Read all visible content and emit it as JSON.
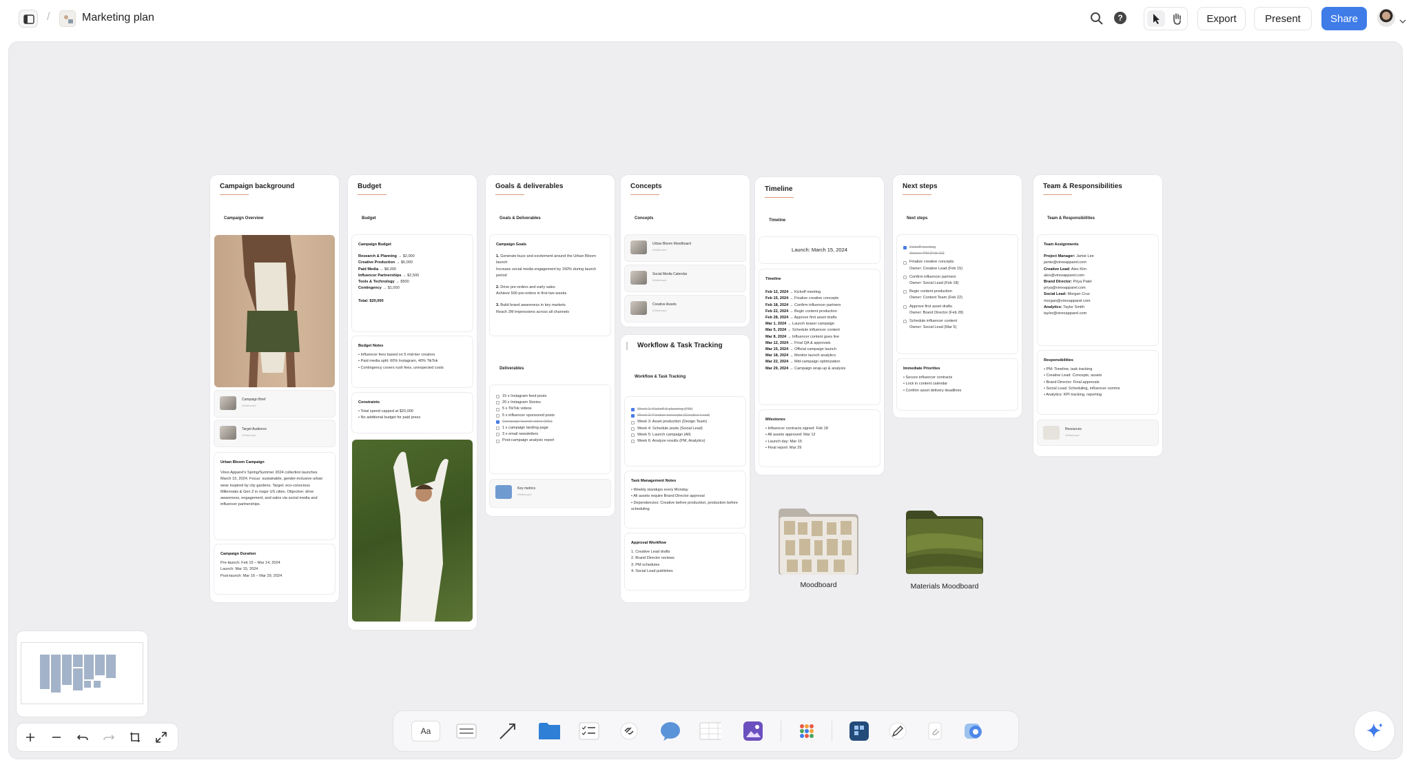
{
  "topbar": {
    "title": "Marketing plan",
    "export": "Export",
    "present": "Present",
    "share": "Share",
    "accent": "#3f7ce8"
  },
  "columns": [
    {
      "title": "Campaign background",
      "sub": "Campaign Overview",
      "minis": [
        {
          "t": "Campaign Brief",
          "s": "Whiteboard"
        },
        {
          "t": "Target Audience",
          "s": "Whiteboard"
        }
      ],
      "card_urban": {
        "h": "Urban Bloom Campaign",
        "body": "Vireo Apparel's Spring/Summer 2024 collection launches March 15, 2024. Focus: sustainable, gender-inclusive urban wear inspired by city gardens. Target: eco-conscious Millennials & Gen Z in major US cities. Objective: drive awareness, engagement, and sales via social media and influencer partnerships."
      },
      "card_duration": {
        "h": "Campaign Duration",
        "l1": "Pre-launch: Feb 15 – Mar 14, 2024",
        "l2": "Launch: Mar 15, 2024",
        "l3": "Post-launch: Mar 16 – Mar 29, 2024"
      }
    },
    {
      "title": "Budget",
      "sub": "Budget",
      "budget": {
        "h": "Campaign Budget",
        "rows": [
          {
            "k": "Research & Planning",
            "v": " → $2,000"
          },
          {
            "k": "Creative Production",
            "v": " → $6,000"
          },
          {
            "k": "Paid Media",
            "v": " → $8,000"
          },
          {
            "k": "Influencer Partnerships",
            "v": " → $2,500"
          },
          {
            "k": "Tools & Technology",
            "v": " → $500"
          },
          {
            "k": "Contingency",
            "v": " → $1,000"
          }
        ],
        "total": "Total: $20,000"
      },
      "notes": {
        "h": "Budget Notes",
        "l1": "• Influencer fees based on 5 mid-tier creators",
        "l2": "• Paid media split: 60% Instagram, 40% TikTok",
        "l3": "• Contingency covers rush fees, unexpected costs"
      },
      "constraints": {
        "h": "Constraints",
        "l1": "• Total spend capped at $20,000",
        "l2": "• No additional budget for paid press"
      }
    },
    {
      "title": "Goals & deliverables",
      "sub": "Goals & Deliverables",
      "goals": {
        "h": "Campaign Goals",
        "g1a": "1.",
        "g1": " Generate buzz and excitement around the Urban Bloom launch",
        "g1b": "Increase social media engagement by 150% during launch period",
        "g2a": "2.",
        "g2": " Drive pre-orders and early sales",
        "g2b": "Achieve 500 pre-orders in first two weeks",
        "g3a": "3.",
        "g3": " Build brand awareness in key markets",
        "g3b": "Reach 2M impressions across all channels"
      },
      "deliv_sub": "Deliverables",
      "deliverables": [
        "15 x Instagram feed posts",
        "20 x Instagram Stories",
        "5 x TikTok videos",
        "5 x influencer sponsored posts",
        "Campaign launch video (60s)",
        "1 x campaign landing page",
        "3 x email newsletters",
        "Post-campaign analysis report"
      ],
      "mini": {
        "t": "Key metrics",
        "s": "Whiteboard"
      }
    },
    {
      "title": "Concepts",
      "sub": "Concepts",
      "minis": [
        {
          "t": "Urban Bloom Moodboard",
          "s": "Whiteboard"
        },
        {
          "t": "Social Media Calendar",
          "s": "Whiteboard"
        },
        {
          "t": "Creative Assets",
          "s": "Whiteboard"
        }
      ]
    },
    {
      "title": "Workflow & Task Tracking",
      "sub": "Workflow & Task Tracking",
      "weeks": [
        "Week 1: Kickoff & planning (PM)",
        "Week 2: Finalize concepts (Creative Lead)",
        "Week 3: Asset production (Design Team)",
        "Week 4: Schedule posts (Social Lead)",
        "Week 5: Launch campaign (All)",
        "Week 6: Analyze results (PM, Analytics)"
      ],
      "task_notes": {
        "h": "Task Management Notes",
        "l1": "• Weekly standups every Monday",
        "l2": "• All assets require Brand Director approval",
        "l3": "• Dependencies: Creative before production, production before scheduling"
      },
      "approval": {
        "h": "Approval Workflow",
        "l1": "1. Creative Lead drafts",
        "l2": "2. Brand Director reviews",
        "l3": "3. PM schedules",
        "l4": "4. Social Lead publishes"
      }
    },
    {
      "title": "Timeline",
      "sub": "Timeline",
      "launch": "Launch: March 15, 2024",
      "tl_h": "Timeline",
      "timeline": [
        {
          "d": "Feb 12, 2024",
          "e": " → Kickoff meeting"
        },
        {
          "d": "Feb 15, 2024",
          "e": " → Finalize creative concepts"
        },
        {
          "d": "Feb 18, 2024",
          "e": " → Confirm influencer partners"
        },
        {
          "d": "Feb 22, 2024",
          "e": " → Begin content production"
        },
        {
          "d": "Feb 28, 2024",
          "e": " → Approve first asset drafts"
        },
        {
          "d": "Mar 1, 2024",
          "e": " → Launch teaser campaign"
        },
        {
          "d": "Mar 5, 2024",
          "e": " → Schedule influencer content"
        },
        {
          "d": "Mar 8, 2024",
          "e": " → Influencer content goes live"
        },
        {
          "d": "Mar 12, 2024",
          "e": " → Final QA & approvals"
        },
        {
          "d": "Mar 15, 2024",
          "e": " → Official campaign launch"
        },
        {
          "d": "Mar 18, 2024",
          "e": " → Monitor launch analytics"
        },
        {
          "d": "Mar 22, 2024",
          "e": " → Mid-campaign optimization"
        },
        {
          "d": "Mar 29, 2024",
          "e": " → Campaign wrap-up & analysis"
        }
      ],
      "milestones": {
        "h": "Milestones",
        "l1": "• Influencer contracts signed: Feb 18",
        "l2": "• All assets approved: Mar 12",
        "l3": "• Launch day: Mar 15",
        "l4": "• Final report: Mar 29"
      }
    },
    {
      "title": "Next steps",
      "sub": "Next steps",
      "steps": [
        {
          "a": "Kickoff meeting",
          "b": "Owner: PM (Feb 12)",
          "done": true
        },
        {
          "a": "Finalize creative concepts",
          "b": "Owner: Creative Lead (Feb 15)",
          "done": false
        },
        {
          "a": "Confirm influencer partners",
          "b": "Owner: Social Lead (Feb 18)",
          "done": false
        },
        {
          "a": "Begin content production",
          "b": "Owner: Content Team (Feb 22)",
          "done": false
        },
        {
          "a": "Approve first asset drafts",
          "b": "Owner: Brand Director (Feb 28)",
          "done": false
        },
        {
          "a": "Schedule influencer content",
          "b": "Owner: Social Lead (Mar 5)",
          "done": false
        }
      ],
      "priorities": {
        "h": "Immediate Priorities",
        "l1": "• Secure influencer contracts",
        "l2": "• Lock in content calendar",
        "l3": "• Confirm asset delivery deadlines"
      }
    },
    {
      "title": "Team & Responsibilities",
      "sub": "Team & Responsibilities",
      "assign": {
        "h": "Team Assignments",
        "people": [
          {
            "r": "Project Manager:",
            "n": " Jamie Lee",
            "e": "jamie@vireoapparel.com"
          },
          {
            "r": "Creative Lead:",
            "n": " Alex Kim",
            "e": "alex@vireoapparel.com"
          },
          {
            "r": "Brand Director:",
            "n": " Priya Patel",
            "e": "priya@vireoapparel.com"
          },
          {
            "r": "Social Lead:",
            "n": " Morgan Cruz",
            "e": "morgan@vireoapparel.com"
          },
          {
            "r": "Analytics:",
            "n": " Taylor Smith",
            "e": "taylor@vireoapparel.com"
          }
        ]
      },
      "resp": {
        "h": "Responsibilities",
        "l1": "• PM: Timeline, task tracking",
        "l2": "• Creative Lead: Concepts, assets",
        "l3": "• Brand Director: Final approvals",
        "l4": "• Social Lead: Scheduling, influencer comms",
        "l5": "• Analytics: KPI tracking, reporting"
      },
      "mini": {
        "t": "Resources",
        "s": "Whiteboard"
      }
    }
  ],
  "folders": [
    {
      "label": "Moodboard"
    },
    {
      "label": "Materials Moodboard"
    }
  ],
  "toolbar": {
    "text_tool": "Aa"
  }
}
